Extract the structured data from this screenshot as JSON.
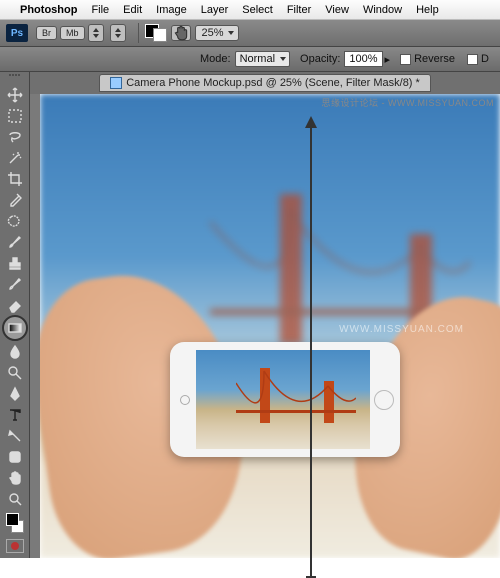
{
  "menubar": {
    "app": "Photoshop",
    "items": [
      "File",
      "Edit",
      "Image",
      "Layer",
      "Select",
      "Filter",
      "View",
      "Window",
      "Help"
    ]
  },
  "optbar": {
    "br_label": "Br",
    "mb_label": "Mb",
    "zoom": "25%"
  },
  "optbar2": {
    "mode_label": "Mode:",
    "mode_value": "Normal",
    "opacity_label": "Opacity:",
    "opacity_value": "100%",
    "reverse_label": "Reverse",
    "dither_label": "D"
  },
  "doc": {
    "title": "Camera Phone Mockup.psd @ 25% (Scene, Filter Mask/8) *"
  },
  "watermark": {
    "top": "思缘设计论坛 - WWW.MISSYUAN.COM",
    "mid": "WWW.MISSYUAN.COM"
  },
  "tools": [
    "move",
    "marquee",
    "lasso",
    "wand",
    "crop",
    "eyedropper",
    "patch",
    "brush",
    "stamp",
    "history",
    "eraser",
    "gradient",
    "blur",
    "dodge",
    "pen",
    "type",
    "path",
    "shape",
    "hand",
    "zoom"
  ]
}
